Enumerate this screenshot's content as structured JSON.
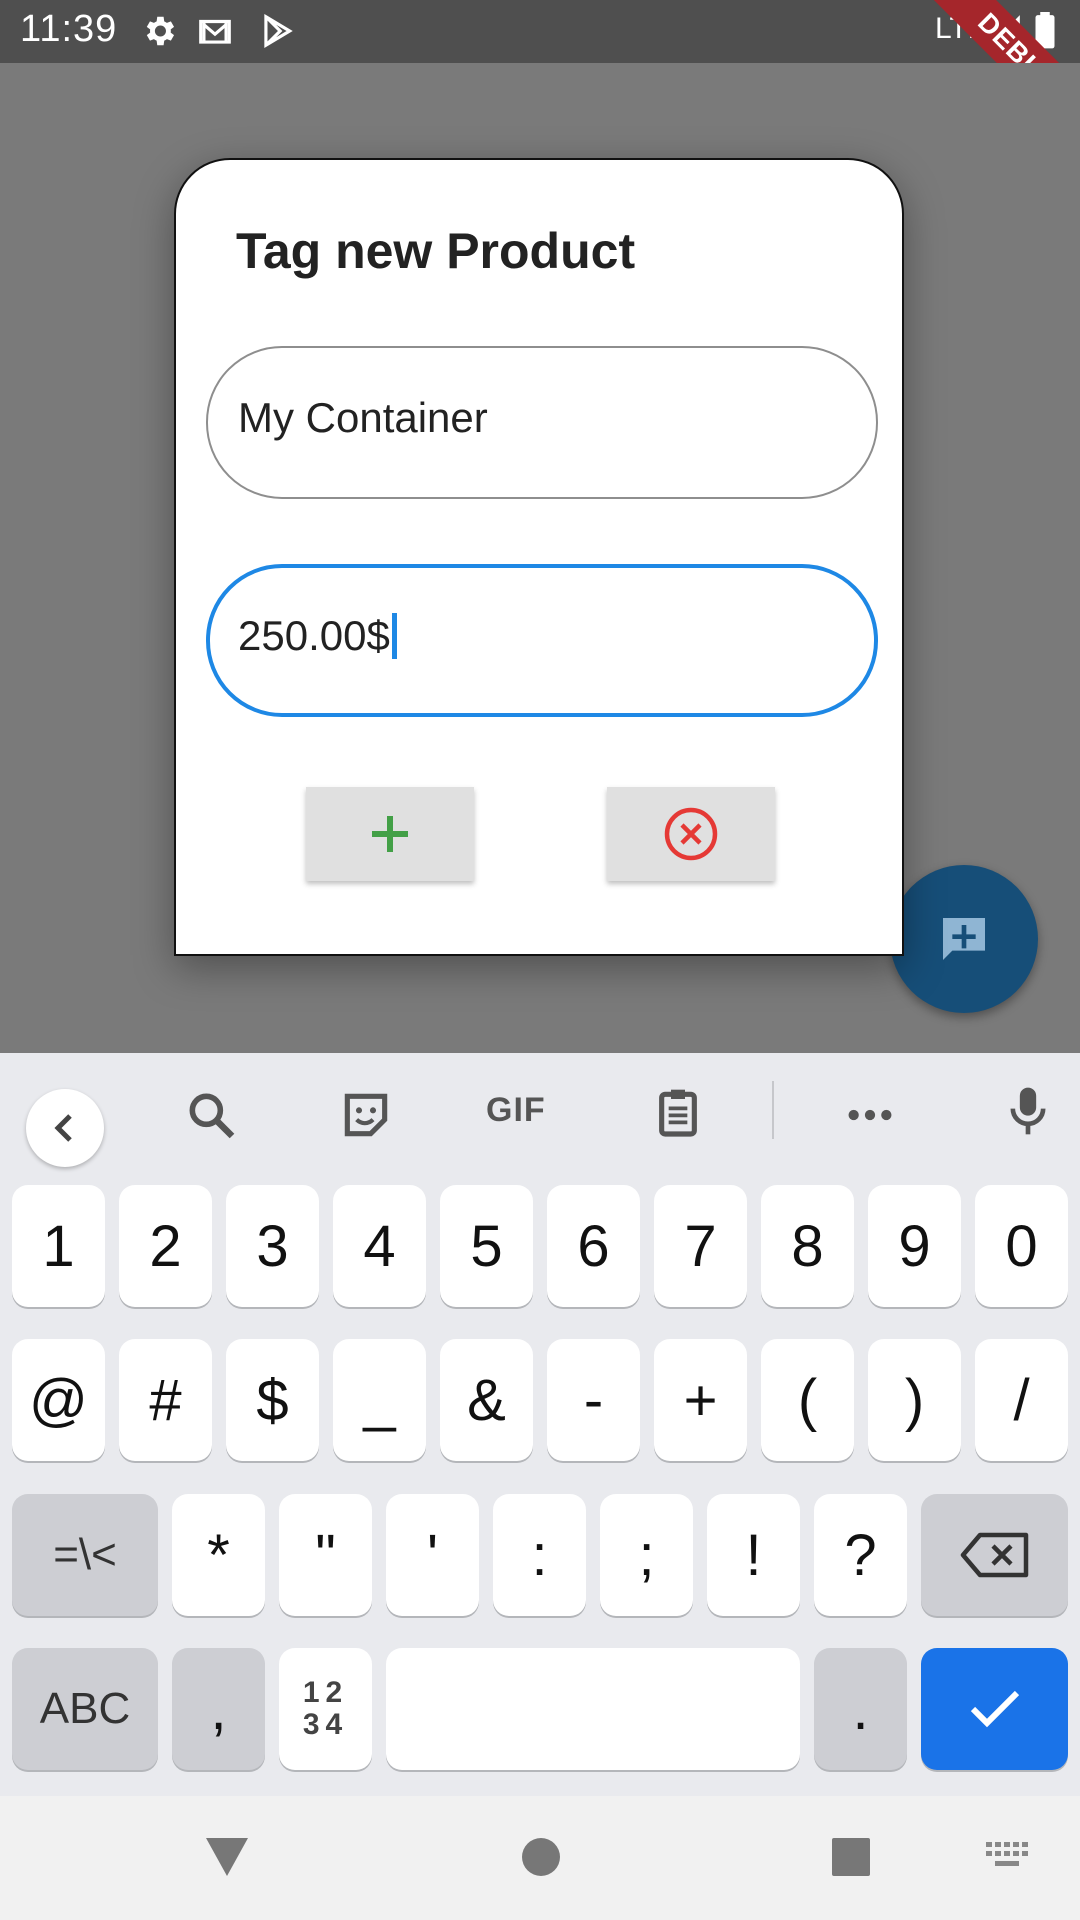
{
  "status_bar": {
    "time": "11:39",
    "network": "LTE",
    "debug_label": "DEBUG"
  },
  "dialog": {
    "title": "Tag new Product",
    "name_field_value": "My Container",
    "price_field_value": "250.00$",
    "add_icon": "plus-icon",
    "cancel_icon": "cancel-circle-icon"
  },
  "keyboard": {
    "toolbar": [
      "back-icon",
      "search-icon",
      "sticker-icon",
      "GIF",
      "clipboard-icon",
      "more-icon",
      "mic-icon"
    ],
    "gif_label": "GIF",
    "row1": [
      "1",
      "2",
      "3",
      "4",
      "5",
      "6",
      "7",
      "8",
      "9",
      "0"
    ],
    "row2": [
      "@",
      "#",
      "$",
      "_",
      "&",
      "-",
      "+",
      "(",
      ")",
      "/"
    ],
    "row3": [
      "=\\<",
      "*",
      "\"",
      "'",
      ":",
      ";",
      "!",
      "?"
    ],
    "row4": {
      "abc": "ABC",
      "comma": ",",
      "num_top": "12",
      "num_bottom": "34",
      "period": "."
    }
  },
  "colors": {
    "accent": "#1e88e5",
    "add_green": "#43a047",
    "cancel_red": "#e53935",
    "fab": "#164e78",
    "enter_key": "#1a73e8"
  }
}
